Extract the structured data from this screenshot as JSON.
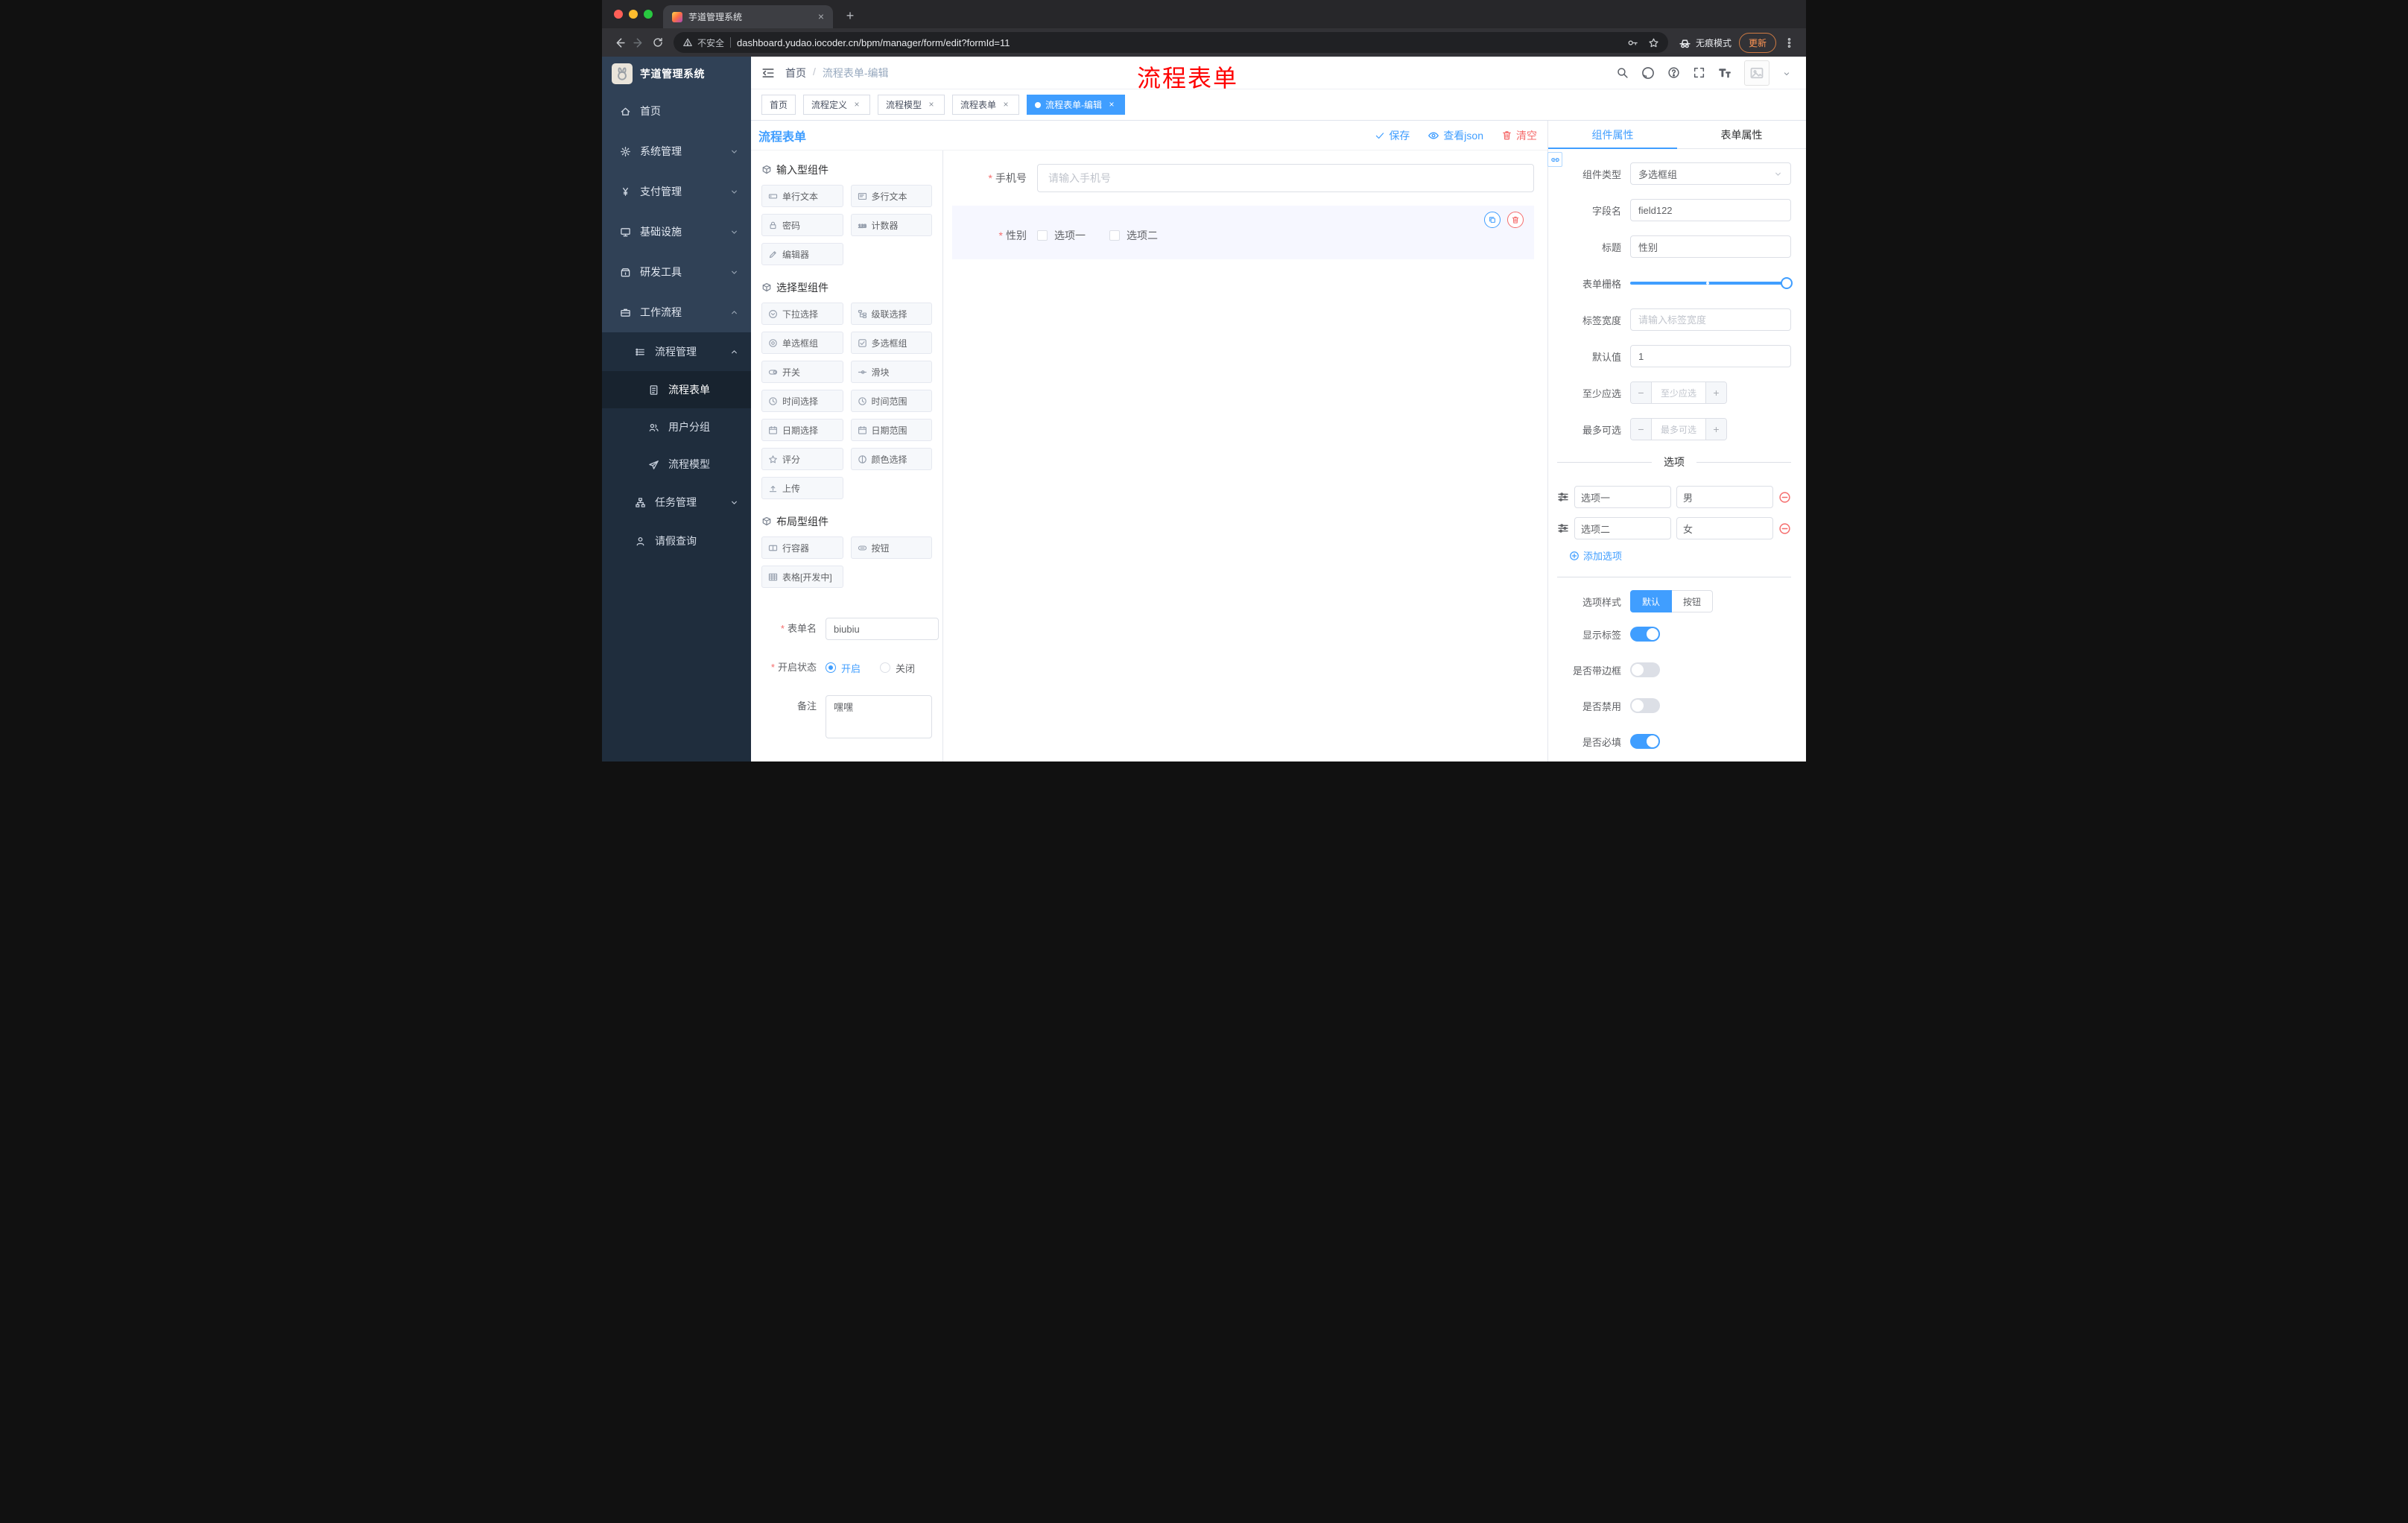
{
  "colors": {
    "accent": "#409eff",
    "danger": "#f56c6c",
    "sidebar_bg": "#304156",
    "submenu_bg": "#1f2d3d",
    "overlay_red": "#fe0000"
  },
  "browser": {
    "tab_title": "芋道管理系统",
    "security_label": "不安全",
    "url": "dashboard.yudao.iocoder.cn/bpm/manager/form/edit?formId=11",
    "incognito_label": "无痕模式",
    "update_label": "更新"
  },
  "sidebar": {
    "logo_title": "芋道管理系统",
    "items": [
      {
        "label": "首页"
      },
      {
        "label": "系统管理"
      },
      {
        "label": "支付管理"
      },
      {
        "label": "基础设施"
      },
      {
        "label": "研发工具"
      },
      {
        "label": "工作流程"
      }
    ],
    "workflow": {
      "manage": {
        "label": "流程管理"
      },
      "children": [
        {
          "label": "流程表单"
        },
        {
          "label": "用户分组"
        },
        {
          "label": "流程模型"
        }
      ],
      "tasks": {
        "label": "任务管理"
      },
      "leave": {
        "label": "请假查询"
      }
    }
  },
  "navbar": {
    "breadcrumb_home": "首页",
    "breadcrumb_sep": "/",
    "breadcrumb_current": "流程表单-编辑",
    "overlay_title": "流程表单"
  },
  "tags": [
    {
      "label": "首页"
    },
    {
      "label": "流程定义"
    },
    {
      "label": "流程模型"
    },
    {
      "label": "流程表单"
    },
    {
      "label": "流程表单-编辑"
    }
  ],
  "designer": {
    "title": "流程表单",
    "actions": {
      "save": "保存",
      "view_json": "查看json",
      "clear": "清空"
    },
    "palette": {
      "groups": [
        {
          "title": "输入型组件",
          "items": [
            "单行文本",
            "多行文本",
            "密码",
            "计数器",
            "编辑器"
          ]
        },
        {
          "title": "选择型组件",
          "items": [
            "下拉选择",
            "级联选择",
            "单选框组",
            "多选框组",
            "开关",
            "滑块",
            "时间选择",
            "时间范围",
            "日期选择",
            "日期范围",
            "评分",
            "颜色选择",
            "上传"
          ]
        },
        {
          "title": "布局型组件",
          "items": [
            "行容器",
            "按钮",
            "表格[开发中]"
          ]
        }
      ]
    },
    "meta": {
      "name_label": "表单名",
      "name_value": "biubiu",
      "status_label": "开启状态",
      "status_on": "开启",
      "status_off": "关闭",
      "remark_label": "备注",
      "remark_value": "嘿嘿"
    },
    "canvas": {
      "phone": {
        "label": "手机号",
        "placeholder": "请输入手机号"
      },
      "gender": {
        "label": "性别",
        "option1": "选项一",
        "option2": "选项二"
      }
    },
    "panel": {
      "tab_component": "组件属性",
      "tab_form": "表单属性",
      "rows": {
        "type_label": "组件类型",
        "type_value": "多选框组",
        "field_label": "字段名",
        "field_value": "field122",
        "title_label": "标题",
        "title_value": "性别",
        "grid_label": "表单栅格",
        "width_label": "标签宽度",
        "width_placeholder": "请输入标签宽度",
        "default_label": "默认值",
        "default_value": "1",
        "min_label": "至少应选",
        "min_placeholder": "至少应选",
        "max_label": "最多可选",
        "max_placeholder": "最多可选"
      },
      "stepper": {
        "minus": "−",
        "plus": "+"
      },
      "options": {
        "divider": "选项",
        "rows": [
          {
            "name": "选项一",
            "value": "男"
          },
          {
            "name": "选项二",
            "value": "女"
          }
        ],
        "add": "添加选项"
      },
      "style": {
        "label": "选项样式",
        "default": "默认",
        "button": "按钮"
      },
      "toggles": [
        {
          "label": "显示标签",
          "on": true
        },
        {
          "label": "是否带边框",
          "on": false
        },
        {
          "label": "是否禁用",
          "on": false
        },
        {
          "label": "是否必填",
          "on": true
        }
      ]
    }
  }
}
